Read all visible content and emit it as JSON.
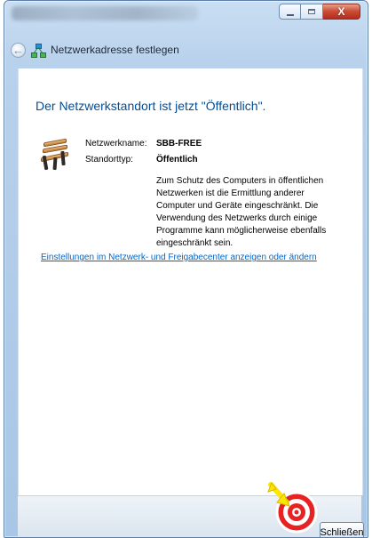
{
  "window": {
    "title_bar_text": "",
    "minimize_icon": "minimize-icon",
    "maximize_icon": "maximize-icon",
    "close_label": "X"
  },
  "navigation": {
    "back_icon": "back-arrow-icon",
    "network_icon": "network-icon",
    "dialog_title": "Netzwerkadresse festlegen"
  },
  "main": {
    "heading": "Der Netzwerkstandort ist jetzt \"Öffentlich\".",
    "location_icon": "bench-icon",
    "details": [
      {
        "label": "Netzwerkname:",
        "value": "SBB-FREE"
      },
      {
        "label": "Standorttyp:",
        "value": "Öffentlich"
      }
    ],
    "description": "Zum Schutz des Computers in öffentlichen Netzwerken ist die Ermittlung anderer Computer und Geräte eingeschränkt. Die Verwendung des Netzwerks durch einige Programme kann möglicherweise ebenfalls eingeschränkt sein.",
    "settings_link": "Einstellungen im Netzwerk- und Freigabecenter anzeigen oder ändern"
  },
  "footer": {
    "close_button_label": "Schließen",
    "annotation_icon": "target-arrow-icon"
  },
  "colors": {
    "accent_blue": "#004e9a",
    "link_blue": "#0066cc",
    "target_red": "#e62222",
    "target_yellow": "#ffe600",
    "window_frame": "#a9c6e6"
  }
}
